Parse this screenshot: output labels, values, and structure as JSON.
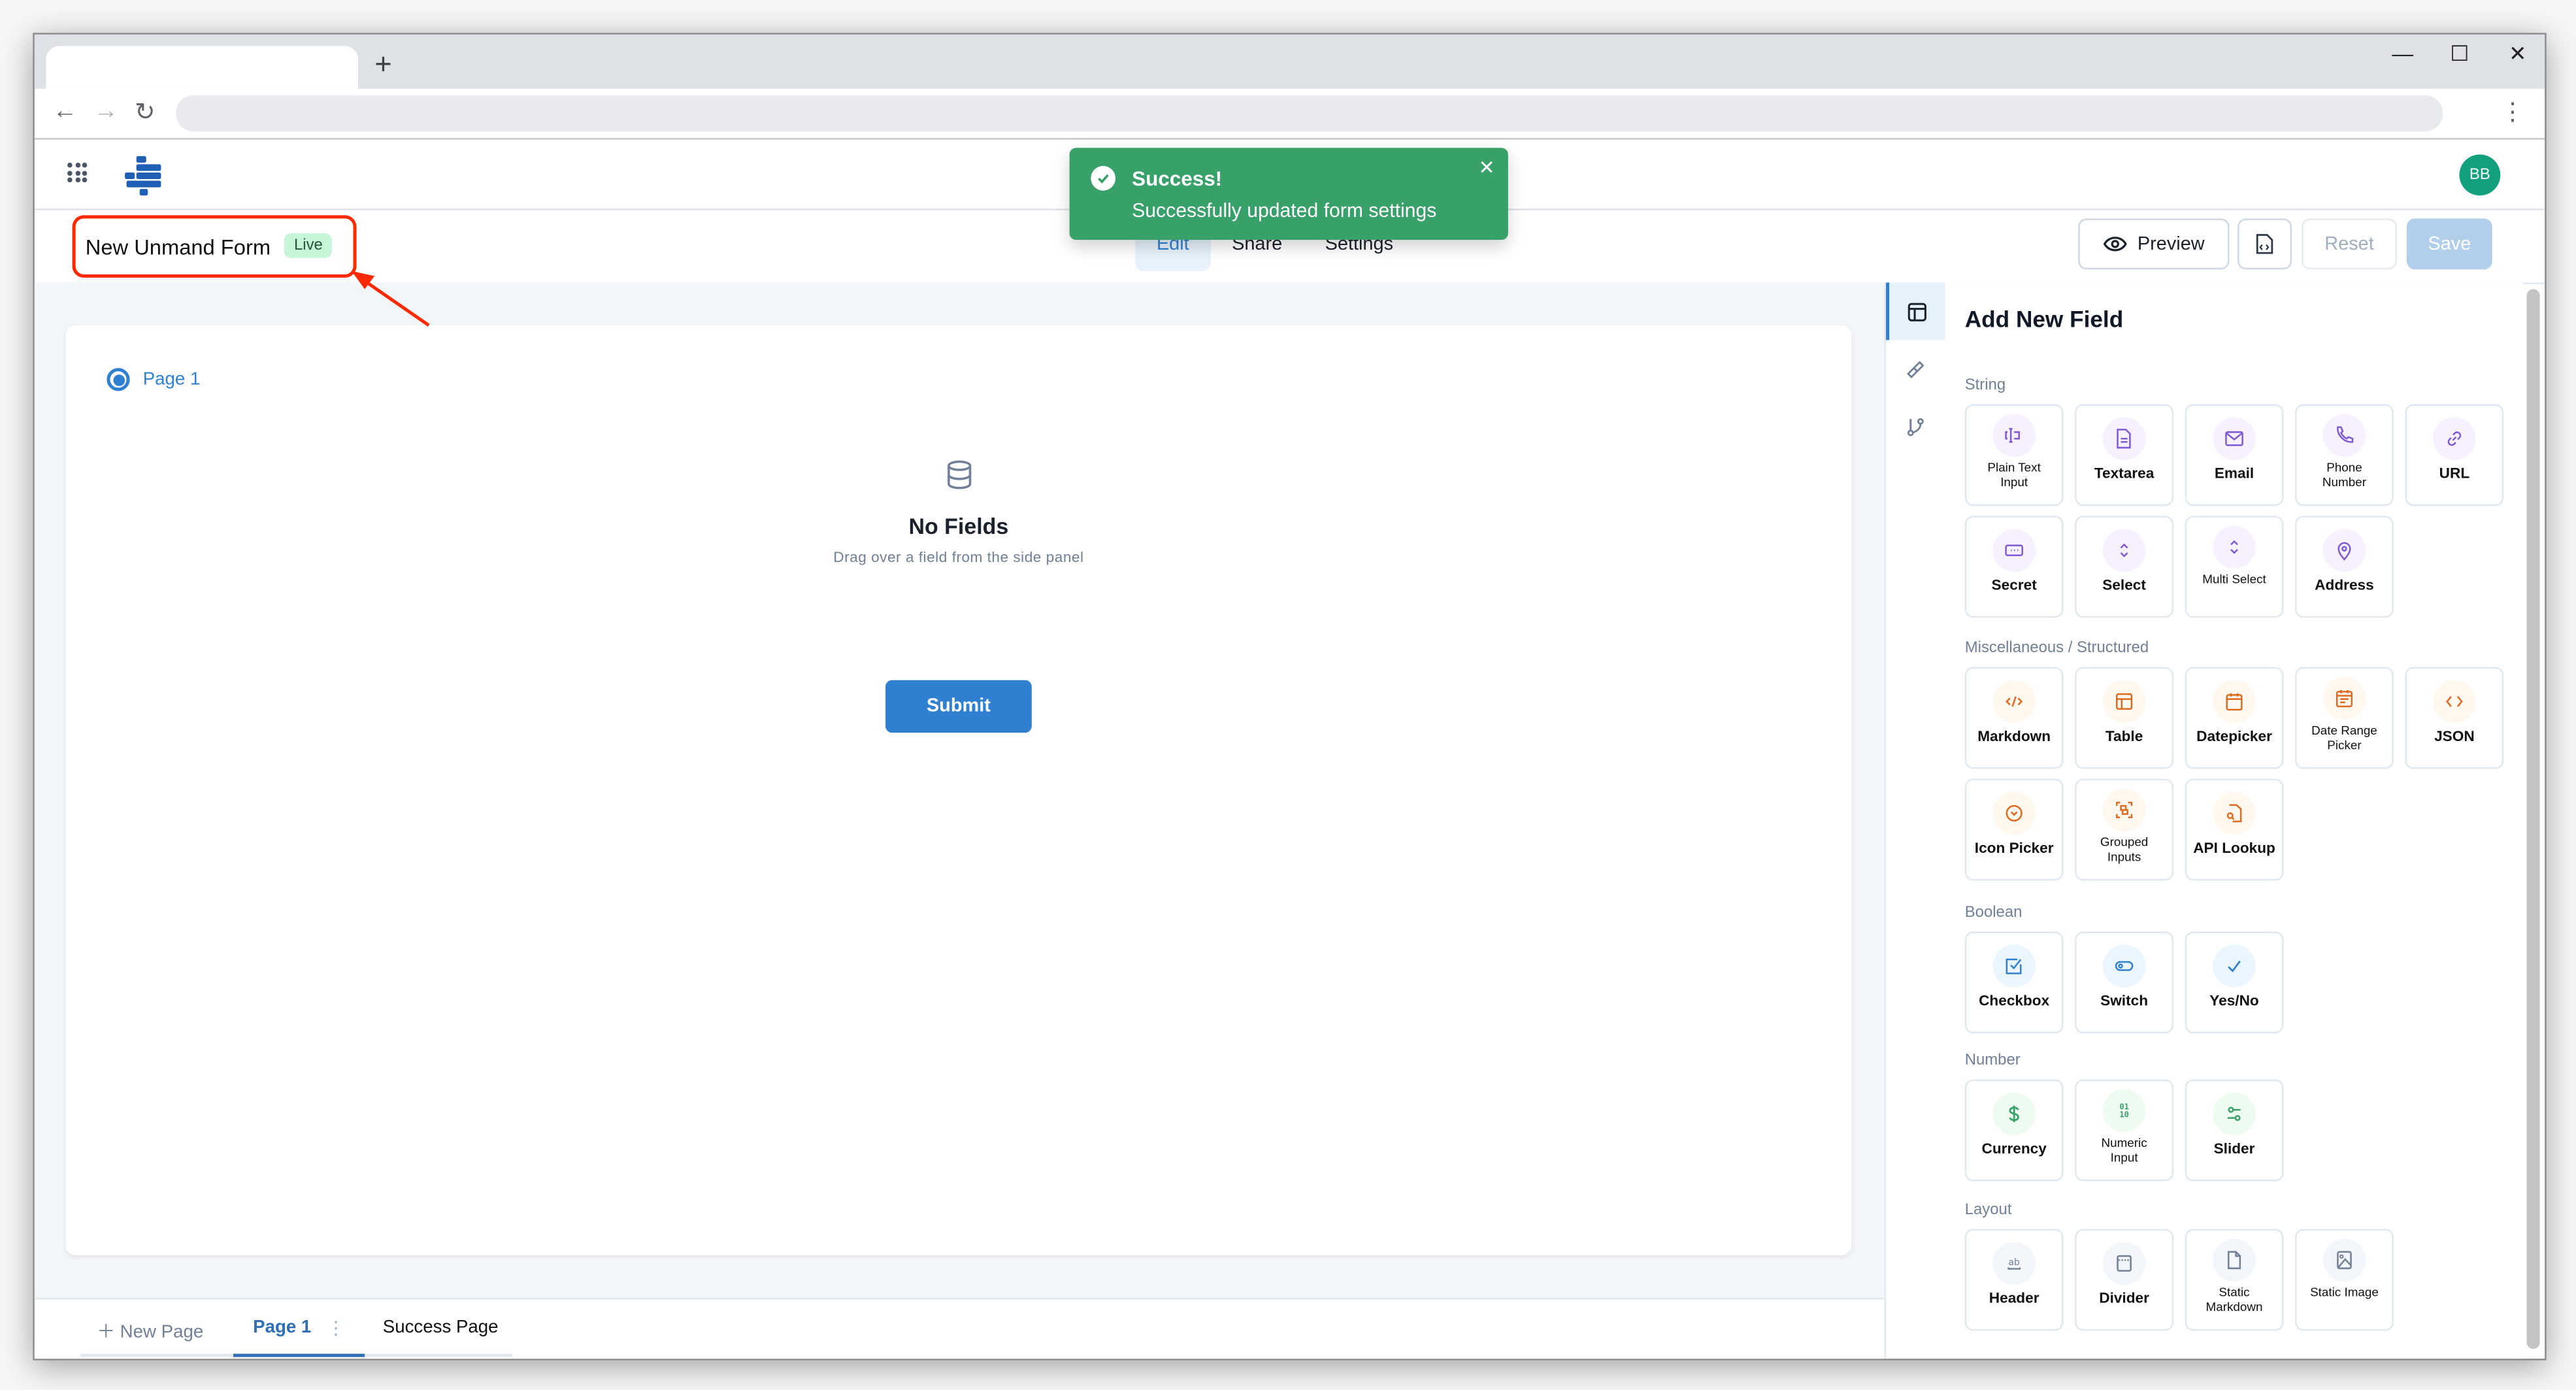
{
  "browser": {
    "new_tab_label": "+",
    "window_controls": {
      "minimize": "—",
      "maximize": "☐",
      "close": "✕"
    }
  },
  "app": {
    "avatar_initials": "BB",
    "brand_color": "#1f5fb4",
    "accent_color": "#2f80d1"
  },
  "form": {
    "title": "New Unmand Form",
    "status_badge": "Live",
    "tabs": [
      {
        "label": "Edit",
        "active": true
      },
      {
        "label": "Share",
        "active": false
      },
      {
        "label": "Settings",
        "active": false
      }
    ],
    "actions": {
      "preview": "Preview",
      "reset": "Reset",
      "save": "Save"
    }
  },
  "toast": {
    "title": "Success!",
    "message": "Successfully updated form settings",
    "close": "✕",
    "color": "#38a169"
  },
  "canvas": {
    "page_indicator": "Page 1",
    "empty_title": "No Fields",
    "empty_subtitle": "Drag over a field from the side panel",
    "submit_label": "Submit"
  },
  "page_tabs": {
    "new_page": "New Page",
    "current": "Page 1",
    "success": "Success Page"
  },
  "panel": {
    "title": "Add New Field",
    "sections": [
      {
        "label": "String",
        "color": "#805ad5",
        "bg": "#f6f0ff",
        "fields": [
          {
            "label": "Plain Text Input",
            "small": true,
            "icon": "text-cursor-icon"
          },
          {
            "label": "Textarea",
            "small": false,
            "icon": "document-icon"
          },
          {
            "label": "Email",
            "small": false,
            "icon": "mail-icon"
          },
          {
            "label": "Phone Number",
            "small": true,
            "icon": "phone-icon"
          },
          {
            "label": "URL",
            "small": false,
            "icon": "link-icon"
          },
          {
            "label": "Secret",
            "small": false,
            "icon": "password-icon"
          },
          {
            "label": "Select",
            "small": false,
            "icon": "selector-icon"
          },
          {
            "label": "Multi Select",
            "small": true,
            "icon": "selector-icon"
          },
          {
            "label": "Address",
            "small": false,
            "icon": "map-pin-icon"
          }
        ]
      },
      {
        "label": "Miscellaneous / Structured",
        "color": "#dd6b20",
        "bg": "#fff8ef",
        "fields": [
          {
            "label": "Markdown",
            "small": false,
            "icon": "code-slash-icon"
          },
          {
            "label": "Table",
            "small": false,
            "icon": "table-icon"
          },
          {
            "label": "Datepicker",
            "small": false,
            "icon": "calendar-icon"
          },
          {
            "label": "Date Range Picker",
            "small": true,
            "icon": "calendar-range-icon"
          },
          {
            "label": "JSON",
            "small": false,
            "icon": "brackets-icon"
          },
          {
            "label": "Icon Picker",
            "small": false,
            "icon": "chevron-circle-icon"
          },
          {
            "label": "Grouped Inputs",
            "small": true,
            "icon": "group-icon"
          },
          {
            "label": "API Lookup",
            "small": false,
            "icon": "file-search-icon"
          }
        ]
      },
      {
        "label": "Boolean",
        "color": "#3182ce",
        "bg": "#eaf5fe",
        "fields": [
          {
            "label": "Checkbox",
            "small": false,
            "icon": "checkbox-icon"
          },
          {
            "label": "Switch",
            "small": false,
            "icon": "toggle-icon"
          },
          {
            "label": "Yes/No",
            "small": false,
            "icon": "check-icon"
          }
        ]
      },
      {
        "label": "Number",
        "color": "#38a169",
        "bg": "#edfbf1",
        "fields": [
          {
            "label": "Currency",
            "small": false,
            "icon": "dollar-icon"
          },
          {
            "label": "Numeric Input",
            "small": true,
            "icon": "binary-icon"
          },
          {
            "label": "Slider",
            "small": false,
            "icon": "slider-icon"
          }
        ]
      },
      {
        "label": "Layout",
        "color": "#718096",
        "bg": "#f2f5f9",
        "fields": [
          {
            "label": "Header",
            "small": false,
            "icon": "heading-icon"
          },
          {
            "label": "Divider",
            "small": false,
            "icon": "divider-icon"
          },
          {
            "label": "Static Markdown",
            "small": true,
            "icon": "file-icon"
          },
          {
            "label": "Static Image",
            "small": true,
            "icon": "image-icon"
          }
        ]
      }
    ]
  }
}
